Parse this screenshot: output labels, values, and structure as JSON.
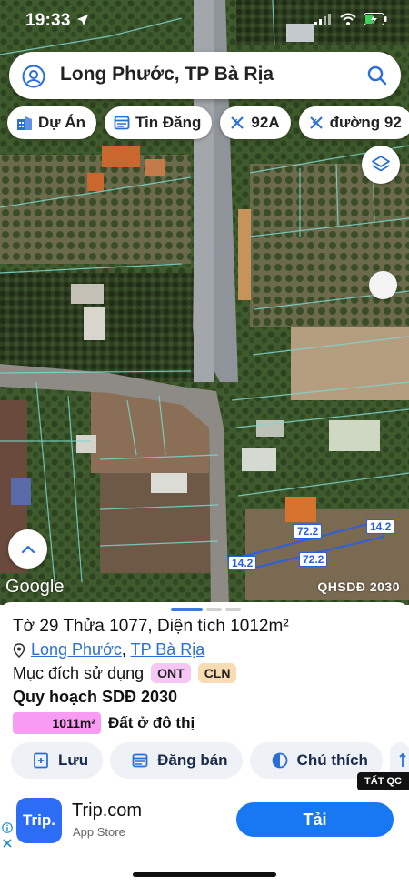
{
  "status": {
    "time": "19:33"
  },
  "search": {
    "text": "Long Phước, TP Bà Rịa"
  },
  "chips": [
    {
      "label": "Dự Án",
      "icon": "building-icon"
    },
    {
      "label": "Tin Đăng",
      "icon": "calendar-list-icon"
    },
    {
      "label": "92A",
      "icon": "ruler-icon"
    },
    {
      "label": "đường 92",
      "icon": "ruler-icon"
    }
  ],
  "map": {
    "google_label": "Google",
    "qhsdd_label": "QHSDĐ 2030",
    "dimensions": [
      "72.2",
      "14.2",
      "14.2",
      "72.2"
    ]
  },
  "sheet": {
    "title": "Tờ 29 Thửa 1077, Diện tích 1012m²",
    "location": {
      "ward": "Long Phước",
      "separator": ", ",
      "city": "TP Bà Rịa"
    },
    "purpose_label": "Mục đích sử dụng",
    "purpose_badges": [
      "ONT",
      "CLN"
    ],
    "plan_title": "Quy hoạch SDĐ 2030",
    "plan_area": "1011m²",
    "plan_area_label": "Đất ở đô thị",
    "actions": [
      {
        "label": "Lưu",
        "icon": "save-icon"
      },
      {
        "label": "Đăng bán",
        "icon": "listing-icon"
      },
      {
        "label": "Chú thích",
        "icon": "legend-icon"
      }
    ],
    "hide_ads": "TẤT QC"
  },
  "ad": {
    "app_icon_text": "Trip.",
    "app_name": "Trip.com",
    "store": "App Store",
    "install": "Tải"
  },
  "colors": {
    "accent": "#1877f2",
    "ont": "#f6c6f4",
    "cln": "#f8dcb3",
    "area_pill": "#f79cf2",
    "parcel_line": "#2c5fe0"
  }
}
